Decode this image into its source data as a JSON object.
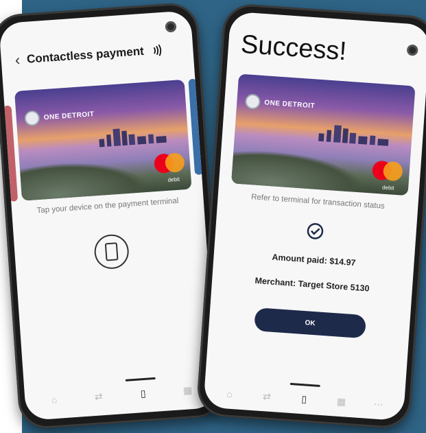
{
  "left_screen": {
    "header_title": "Contactless payment",
    "card_brand": "ONE DETROIT",
    "card_debit_label": "debit",
    "hint": "Tap your device on the payment terminal"
  },
  "right_screen": {
    "title": "Success!",
    "card_brand": "ONE DETROIT",
    "card_debit_label": "debit",
    "hint": "Refer to terminal for transaction status",
    "amount_paid": "Amount paid: $14.97",
    "merchant": "Merchant: Target Store 5130",
    "ok_label": "OK"
  },
  "colors": {
    "background": "#2f6486",
    "button": "#1e2a4a",
    "mastercard_red": "#eb001b",
    "mastercard_orange": "#f79e1b"
  }
}
